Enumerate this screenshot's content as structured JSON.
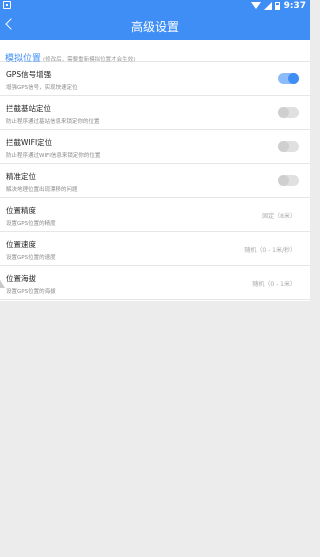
{
  "status_bar": {
    "time": "9:37",
    "icons": [
      "notification-icon",
      "wifi-icon",
      "signal-icon",
      "battery-icon"
    ]
  },
  "app_bar": {
    "back_icon": "back-arrow-icon",
    "title": "高级设置"
  },
  "colors": {
    "accent": "#3f8ef6",
    "toggle_on_track": "#8bbcf9",
    "background": "#ececec"
  },
  "section": {
    "title": "模拟位置",
    "note": "(修改后，需要重新模拟位置才会生效)"
  },
  "rows": [
    {
      "title": "GPS信号增强",
      "desc": "增强GPS信号，实现快速定位",
      "control": "toggle",
      "on": true
    },
    {
      "title": "拦截基站定位",
      "desc": "防止程序通过基站信息来锁定你的位置",
      "control": "toggle",
      "on": false
    },
    {
      "title": "拦截WIFI定位",
      "desc": "防止程序通过WIFI信息来锁定你的位置",
      "control": "toggle",
      "on": false
    },
    {
      "title": "精准定位",
      "desc": "解决地理位置出现漂移的问题",
      "control": "toggle",
      "on": false
    },
    {
      "title": "位置精度",
      "desc": "设置GPS位置的精度",
      "control": "value",
      "value": "固定（8米）"
    },
    {
      "title": "位置速度",
      "desc": "设置GPS位置的速度",
      "control": "value",
      "value": "随机（0 - 1米/秒）"
    },
    {
      "title": "位置海拔",
      "desc": "设置GPS位置的海拔",
      "control": "value",
      "value": "随机（0 - 1米）"
    }
  ]
}
